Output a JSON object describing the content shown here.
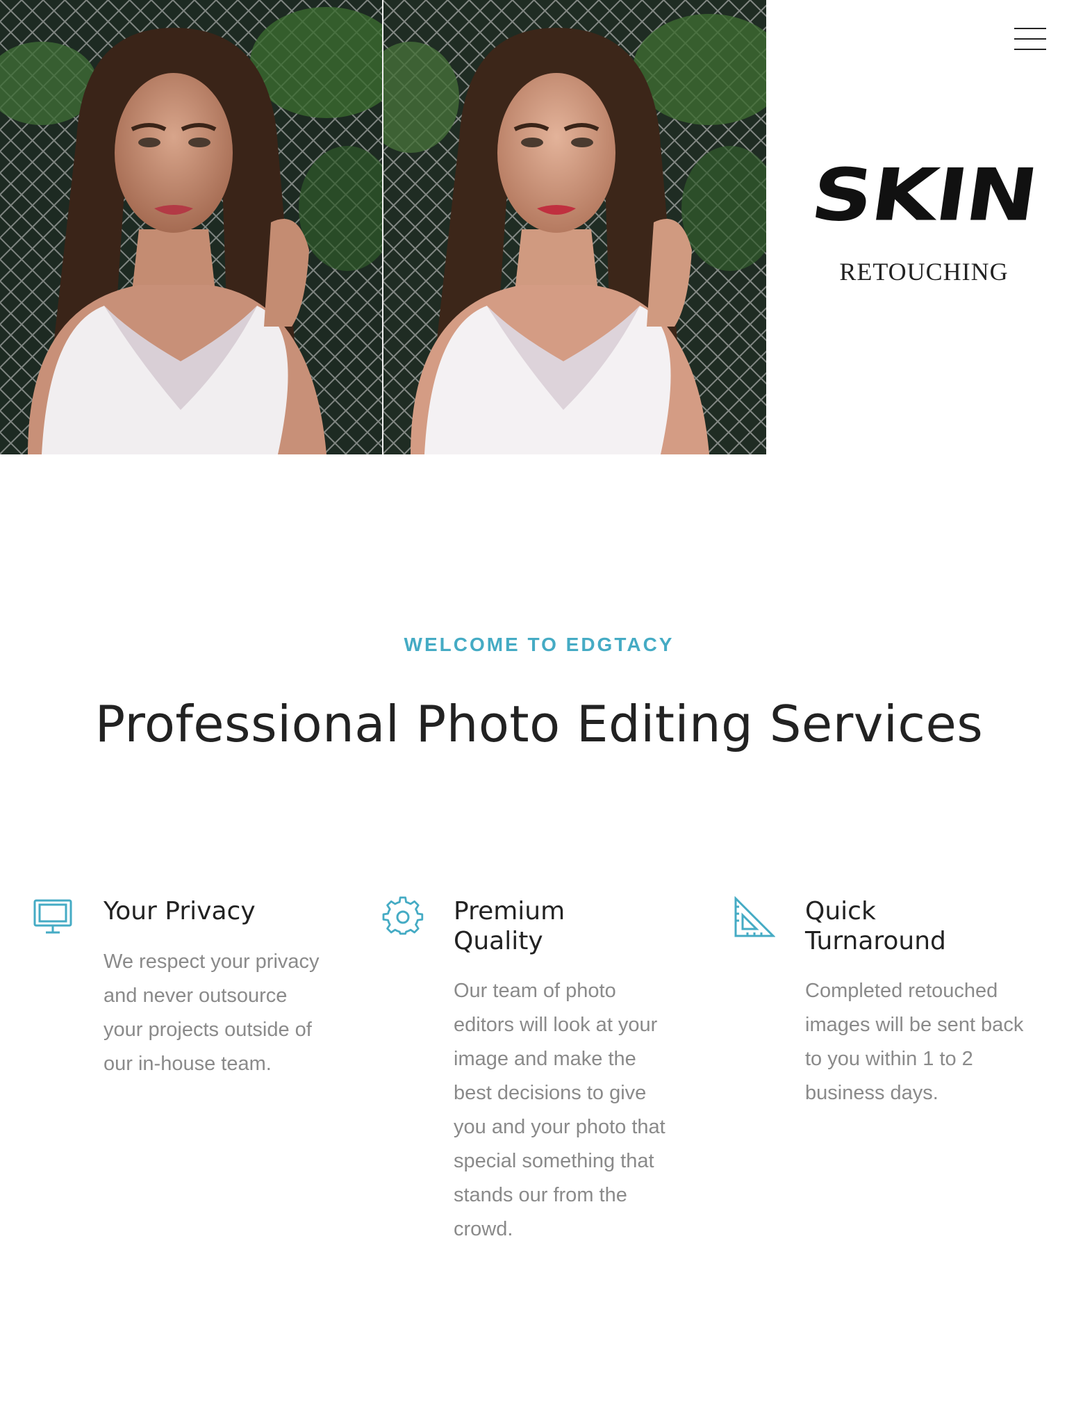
{
  "hero": {
    "logo_word": "SKIN",
    "logo_sub": "RETOUCHING",
    "menu_icon": "hamburger-menu-icon",
    "photos": [
      "before-retouch-photo",
      "after-retouch-photo"
    ]
  },
  "intro": {
    "eyebrow": "WELCOME TO EDGTACY",
    "headline": "Professional Photo Editing Services"
  },
  "features": [
    {
      "icon": "monitor-icon",
      "title": "Your Privacy",
      "text": "We respect your privacy and never outsource your projects outside of our in-house team."
    },
    {
      "icon": "gear-icon",
      "title": "Premium Quality",
      "text": "Our team of photo editors will look at your image and make the best decisions to give you and your photo that special something that stands our from the crowd."
    },
    {
      "icon": "set-square-icon",
      "title": "Quick Turnaround",
      "text": "Completed retouched images will be sent back to you within 1 to 2 business days."
    }
  ],
  "colors": {
    "accent": "#45abc4",
    "heading": "#222222",
    "body_text": "#8a8a8a"
  }
}
